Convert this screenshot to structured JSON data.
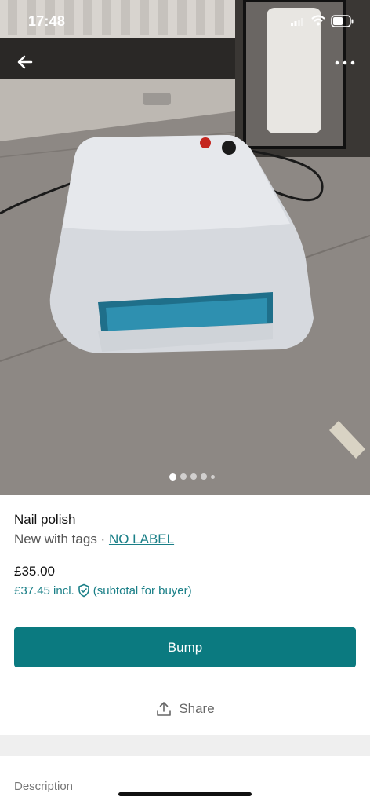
{
  "status_bar": {
    "time": "17:48"
  },
  "listing": {
    "title": "Nail polish",
    "condition": "New with tags",
    "separator": " · ",
    "brand": "NO LABEL",
    "price": "£35.00",
    "buyer_price": "£37.45 incl.",
    "buyer_note": "(subtotal for buyer)",
    "photo_count": 5,
    "active_photo": 1
  },
  "actions": {
    "bump_label": "Bump",
    "share_label": "Share"
  },
  "sections": {
    "description_label": "Description"
  },
  "colors": {
    "accent": "#0b7a80",
    "link": "#1a7f87"
  },
  "icons": [
    "back-arrow-icon",
    "more-dots-icon",
    "shield-check-icon",
    "share-icon",
    "signal-icon",
    "wifi-icon",
    "battery-icon"
  ]
}
